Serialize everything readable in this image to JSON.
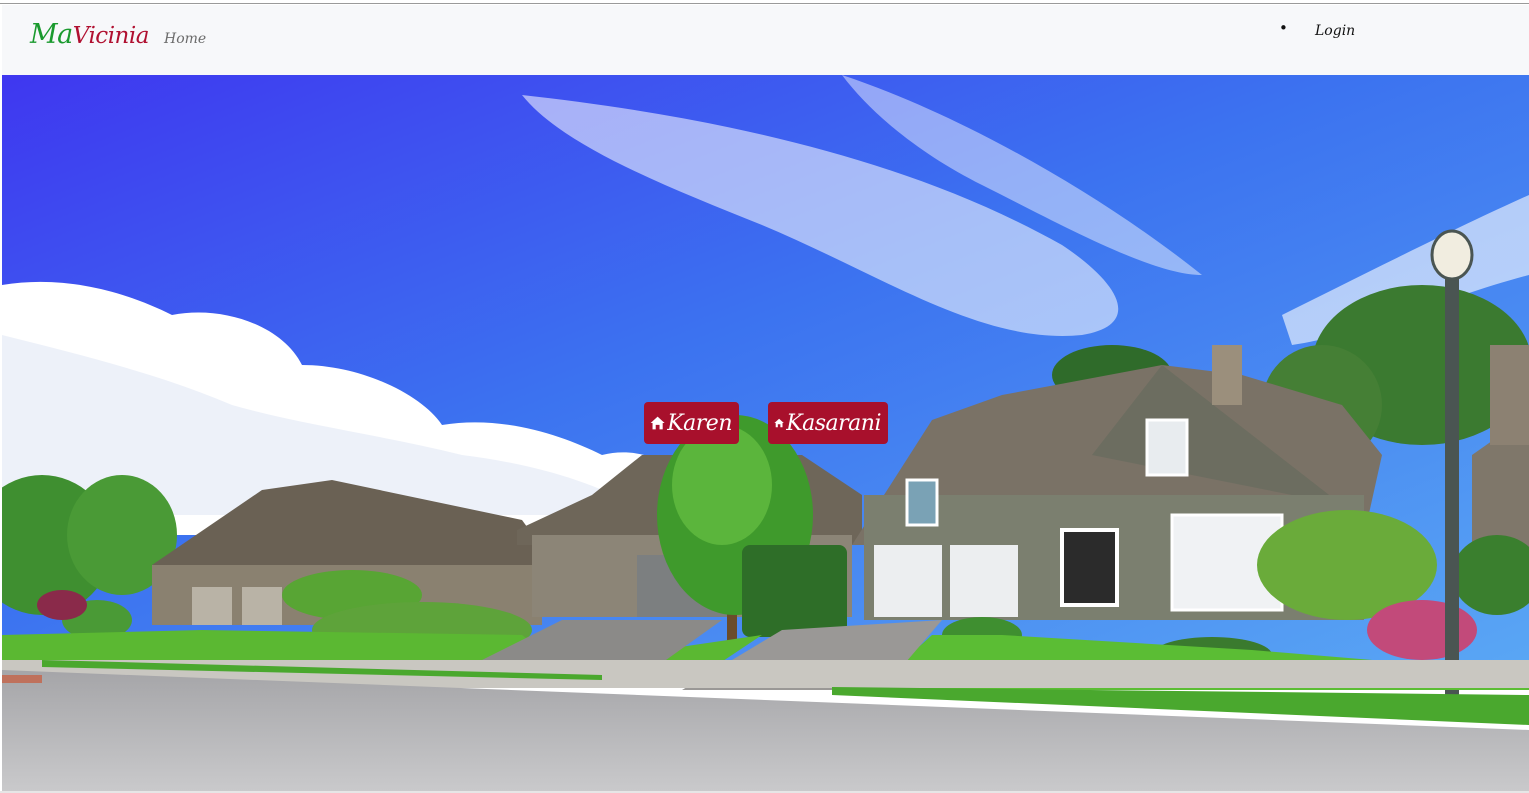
{
  "navbar": {
    "brand_prefix": "Ma",
    "brand_suffix": "Vicinia",
    "home_link": "Home",
    "bullet": "•",
    "login_link": "Login"
  },
  "hero": {
    "image_description_icon": "suburban-houses-hero-image",
    "locations": [
      {
        "label": "Karen",
        "icon": "home-icon"
      },
      {
        "label": "Kasarani",
        "icon": "home-icon"
      }
    ],
    "button_color": "#a8102c"
  },
  "colors": {
    "brand_green": "#1a9a2e",
    "brand_red": "#b01030",
    "navbar_bg": "#f7f8fa"
  }
}
